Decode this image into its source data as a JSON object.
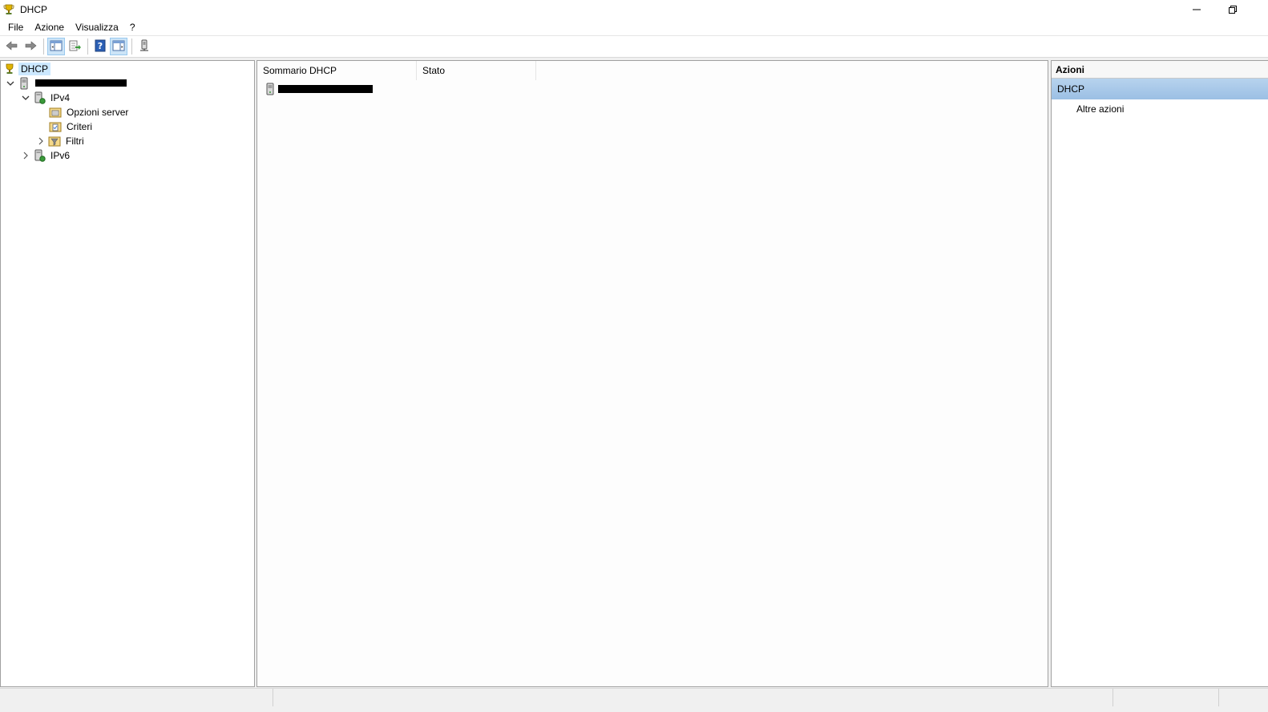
{
  "window": {
    "title": "DHCP",
    "icon": "dhcp-trophy-icon"
  },
  "menu": {
    "items": [
      "File",
      "Azione",
      "Visualizza",
      "?"
    ]
  },
  "toolbar": {
    "buttons": [
      "back-arrow-icon",
      "forward-arrow-icon",
      "show-hide-tree-icon",
      "export-list-icon",
      "help-icon",
      "show-hide-action-pane-icon",
      "server-refresh-icon"
    ]
  },
  "tree": {
    "root": "DHCP",
    "server": "",
    "ipv4": "IPv4",
    "server_options": "Opzioni server",
    "policies": "Criteri",
    "filters": "Filtri",
    "ipv6": "IPv6"
  },
  "list": {
    "columns": [
      "Sommario DHCP",
      "Stato"
    ],
    "rows": [
      {
        "name": "",
        "status": ""
      }
    ]
  },
  "actions": {
    "title": "Azioni",
    "group": "DHCP",
    "items": [
      "Altre azioni"
    ]
  },
  "colors": {
    "selection": "#cce8ff",
    "actions_group": "#9bbfe4"
  }
}
